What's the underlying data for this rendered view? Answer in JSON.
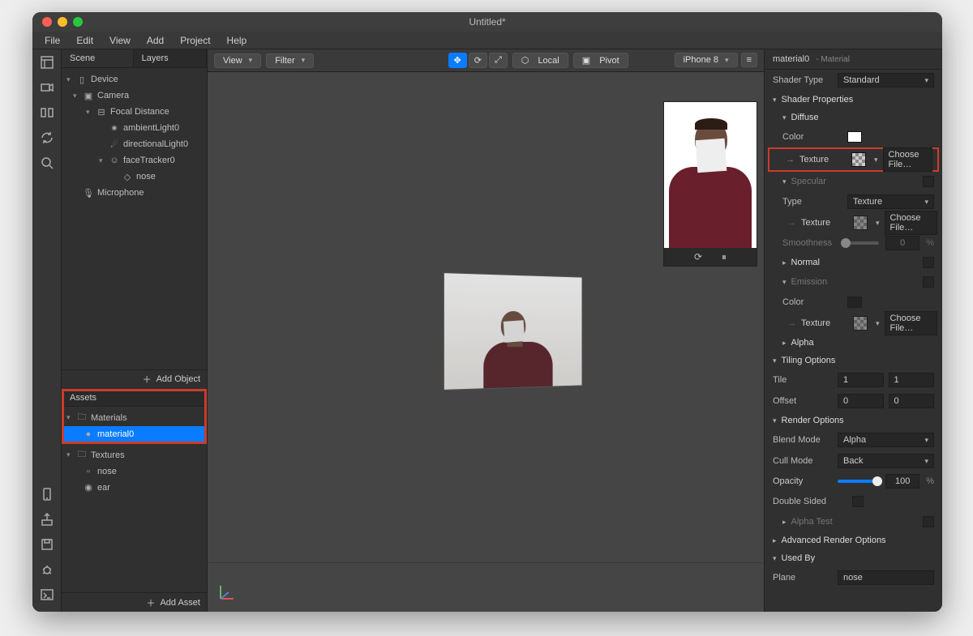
{
  "window": {
    "title": "Untitled*"
  },
  "menu": [
    "File",
    "Edit",
    "View",
    "Add",
    "Project",
    "Help"
  ],
  "sidebar": {
    "tabs": {
      "scene": "Scene",
      "layers": "Layers"
    },
    "scene": {
      "device": "Device",
      "camera": "Camera",
      "focal": "Focal Distance",
      "ambient": "ambientLight0",
      "directional": "directionalLight0",
      "facetracker": "faceTracker0",
      "nose": "nose",
      "microphone": "Microphone"
    },
    "add_object": "Add Object",
    "assets": {
      "header": "Assets",
      "materials_folder": "Materials",
      "material0": "material0",
      "textures_folder": "Textures",
      "nose_tex": "nose",
      "ear_tex": "ear",
      "add_asset": "Add Asset"
    }
  },
  "viewportToolbar": {
    "view": "View",
    "filter": "Filter",
    "local": "Local",
    "pivot": "Pivot",
    "device": "iPhone 8"
  },
  "inspector": {
    "title": "material0",
    "subtitle": "- Material",
    "shader_type_label": "Shader Type",
    "shader_type_value": "Standard",
    "shader_properties": "Shader Properties",
    "diffuse": "Diffuse",
    "color_label": "Color",
    "texture_label": "Texture",
    "choose_file": "Choose File…",
    "specular": "Specular",
    "type_label": "Type",
    "type_value": "Texture",
    "smoothness": "Smoothness",
    "smoothness_value": "0",
    "normal": "Normal",
    "emission": "Emission",
    "alpha": "Alpha",
    "tiling_options": "Tiling Options",
    "tile_label": "Tile",
    "tile_x": "1",
    "tile_y": "1",
    "offset_label": "Offset",
    "offset_x": "0",
    "offset_y": "0",
    "render_options": "Render Options",
    "blend_mode_label": "Blend Mode",
    "blend_mode_value": "Alpha",
    "cull_mode_label": "Cull Mode",
    "cull_mode_value": "Back",
    "opacity_label": "Opacity",
    "opacity_value": "100",
    "double_sided": "Double Sided",
    "alpha_test": "Alpha Test",
    "advanced_render": "Advanced Render Options",
    "used_by": "Used By",
    "plane_label": "Plane",
    "plane_value": "nose"
  }
}
